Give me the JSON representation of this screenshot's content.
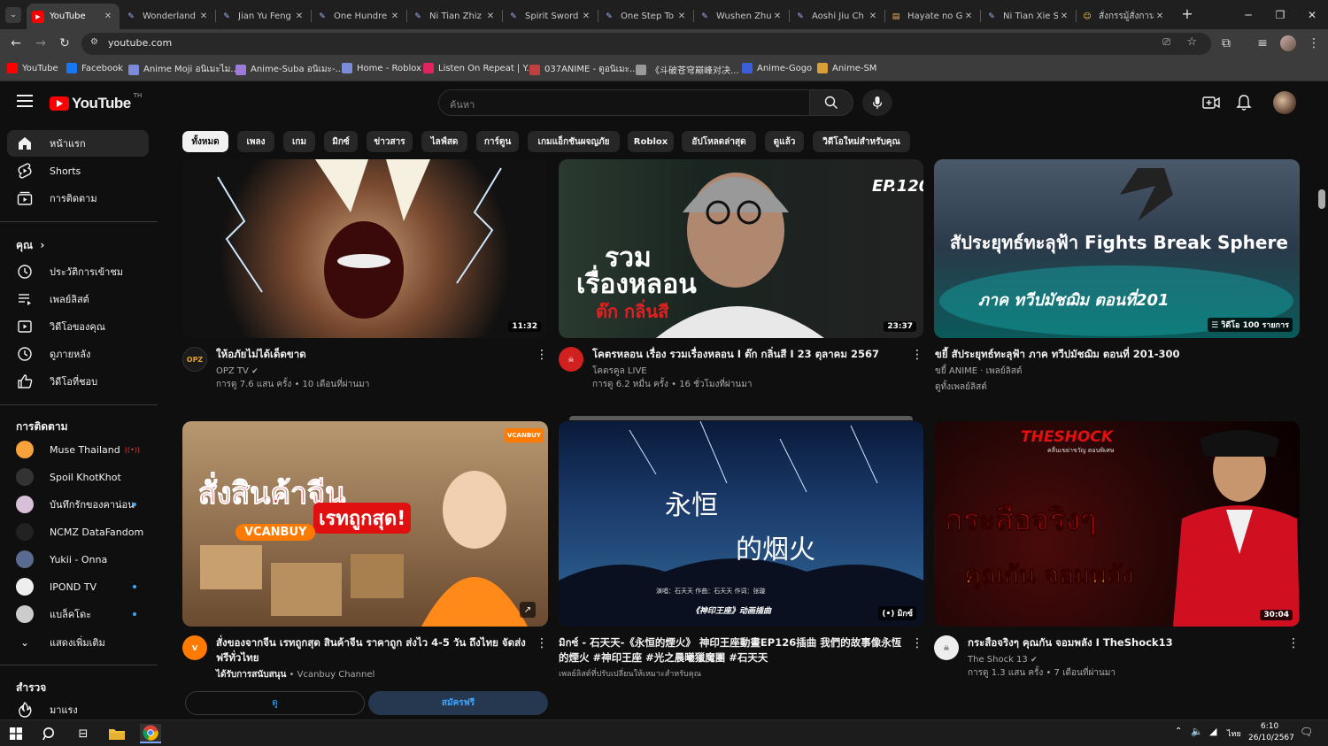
{
  "browser": {
    "tabs": [
      {
        "label": "YouTube",
        "icon": "youtube-icon",
        "active": true
      },
      {
        "label": "Wonderland",
        "icon": "pen-icon"
      },
      {
        "label": "Jian Yu Feng",
        "icon": "pen-icon"
      },
      {
        "label": "One Hundre",
        "icon": "pen-icon"
      },
      {
        "label": "Ni Tian Zhiz",
        "icon": "pen-icon"
      },
      {
        "label": "Spirit Sword",
        "icon": "pen-icon"
      },
      {
        "label": "One Step To",
        "icon": "pen-icon"
      },
      {
        "label": "Wushen Zhu",
        "icon": "pen-icon"
      },
      {
        "label": "Aoshi Jiu Ch",
        "icon": "pen-icon"
      },
      {
        "label": "Hayate no G",
        "icon": "manga-icon"
      },
      {
        "label": "Ni Tian Xie S",
        "icon": "pen-icon"
      },
      {
        "label": "สั่งกรรมู้สั่งกาน",
        "icon": "emoji-icon"
      }
    ],
    "new_tab": "+",
    "url": "youtube.com",
    "bookmarks": [
      {
        "label": "YouTube",
        "color": "#ff0000"
      },
      {
        "label": "Facebook",
        "color": "#1877f2"
      },
      {
        "label": "Anime Moji อนิเมะไม...",
        "color": "#7b8bd9"
      },
      {
        "label": "Anime-Suba อนิเมะ-...",
        "color": "#9c7bd9"
      },
      {
        "label": "Home - Roblox",
        "color": "#7b8bd9"
      },
      {
        "label": "Listen On Repeat | Y...",
        "color": "#e0245e"
      },
      {
        "label": "037ANIME - ดูอนิเมะ...",
        "color": "#c04040"
      },
      {
        "label": "《斗破苍穹巅峰对决...",
        "color": "#999999"
      },
      {
        "label": "Anime-Gogo",
        "color": "#3a5fd9"
      },
      {
        "label": "Anime-SM",
        "color": "#d9a03a"
      }
    ]
  },
  "youtube": {
    "logo_text": "YouTube",
    "region": "TH",
    "search_placeholder": "ค้นหา",
    "chips": [
      "ทั้งหมด",
      "เพลง",
      "เกม",
      "มิกซ์",
      "ข่าวสาร",
      "ไลฟ์สด",
      "การ์ตูน",
      "เกมแอ็กชันผจญภัย",
      "Roblox",
      "อัปโหลดล่าสุด",
      "ดูแล้ว",
      "วิดีโอใหม่สำหรับคุณ"
    ],
    "sidebar": {
      "main": [
        {
          "label": "หน้าแรก",
          "icon": "home-icon"
        },
        {
          "label": "Shorts",
          "icon": "shorts-icon"
        },
        {
          "label": "การติดตาม",
          "icon": "subscriptions-icon"
        }
      ],
      "you_heading": "คุณ",
      "you_chevron": "›",
      "you": [
        {
          "label": "ประวัติการเข้าชม",
          "icon": "history-icon"
        },
        {
          "label": "เพลย์ลิสต์",
          "icon": "playlist-icon"
        },
        {
          "label": "วิดีโอของคุณ",
          "icon": "your-videos-icon"
        },
        {
          "label": "ดูภายหลัง",
          "icon": "watch-later-icon"
        },
        {
          "label": "วิดีโอที่ชอบ",
          "icon": "like-icon"
        }
      ],
      "subs_heading": "การติดตาม",
      "subs": [
        {
          "label": "Muse Thailand",
          "badge": "live",
          "color": "#f7a23b"
        },
        {
          "label": "Spoil KhotKhot",
          "badge": "",
          "color": "#333333"
        },
        {
          "label": "บันทึกรักของคาน่อน",
          "badge": "new",
          "color": "#d8c0d8"
        },
        {
          "label": "NCMZ DataFandom",
          "badge": "",
          "color": "#222222"
        },
        {
          "label": "Yukii - Onna",
          "badge": "",
          "color": "#5a6a90"
        },
        {
          "label": "IPOND TV",
          "badge": "new",
          "color": "#eeeeee"
        },
        {
          "label": "แบล็คโดะ",
          "badge": "new",
          "color": "#cccccc"
        }
      ],
      "show_more": "แสดงเพิ่มเติม",
      "explore_heading": "สำรวจ",
      "explore": [
        {
          "label": "มาแรง",
          "icon": "trending-icon"
        }
      ]
    },
    "videos": [
      {
        "title": "ให้อภัยไม่ได้เด็ดขาด",
        "channel": "OPZ TV",
        "verified": true,
        "stats": "การดู 7.6 แสน ครั้ง • 10 เดือนที่ผ่านมา",
        "duration": "11:32",
        "avatar_text": "OPZ"
      },
      {
        "title": "โคตรหลอน เรื่อง รวมเรื่องหลอน I ต๊ก กลิ่นสี I 23 ตุลาคม 2567",
        "channel": "โคตรคูล LIVE",
        "verified": false,
        "stats": "การดู 6.2 หมื่น ครั้ง • 16 ชั่วโมงที่ผ่านมา",
        "duration": "23:37",
        "thumb_lines": [
          "รวม",
          "เรื่องหลอน",
          "ต๊ก กลิ่นสี"
        ],
        "ep": "EP.120"
      },
      {
        "title": "ขยี้ สัประยุทธ์ทะลุฟ้า ภาค ทวีปมัชฌิม ตอนที่ 201-300",
        "channel": "ขยี้ ANIME · เพลย์ลิสต์",
        "verified": false,
        "stats": "ดูทั้งเพลย์ลิสต์",
        "duration": "วิดีโอ 100 รายการ",
        "thumb_lines": [
          "สัประยุทธ์ทะลุฟ้า Fights Break Sphere",
          "ภาค ทวีปมัชฌิม ตอนที่201"
        ]
      },
      {
        "title": "สั่งของจากจีน เรทถูกสุด สินค้าจีน ราคาถูก ส่งไว 4-5 วัน ถึงไทย จัดส่งฟรีทั่วไทย",
        "channel": "Vcanbuy Channel",
        "sponsored": "ได้รับการสนับสนุน",
        "stats": "",
        "duration": "",
        "thumb_lines": [
          "สั่งสินค้าจีน",
          "เรทถูกสุด!",
          "VCANBUY"
        ],
        "brand": "VCANBUY",
        "ad_button_1": "ดู",
        "ad_button_2": "สมัครฟรี"
      },
      {
        "title": "มิกซ์ - 石天天-《永恒的煙火》 神印王座動畫EP126插曲 我們的故事像永恆的煙火 #神印王座 #光之晨曦獵魔團 #石天天",
        "channel": "เพลย์ลิสต์ที่ปรับเปลี่ยนให้เหมาะสำหรับคุณ",
        "stats": "",
        "duration": "มิกซ์",
        "thumb_lines": [
          "永恒",
          "的烟火",
          "演唱：石天天    作曲：石天天    作词：张璇",
          "《神印王座》动画插曲"
        ]
      },
      {
        "title": "กระสือจริงๆ คุณกัน จอมพลัง I TheShock13",
        "channel": "The Shock 13",
        "verified": true,
        "stats": "การดู 1.3 แสน ครั้ง • 7 เดือนที่ผ่านมา",
        "duration": "30:04",
        "thumb_lines": [
          "THESHOCK",
          "คลื่นเขย่าขวัญ ตอนพิเศษ",
          "กระสือจริงๆ",
          "คุณกัน จอมพลัง"
        ]
      }
    ]
  },
  "taskbar": {
    "time": "6:10",
    "date": "26/10/2567",
    "lang": "ไทย"
  }
}
